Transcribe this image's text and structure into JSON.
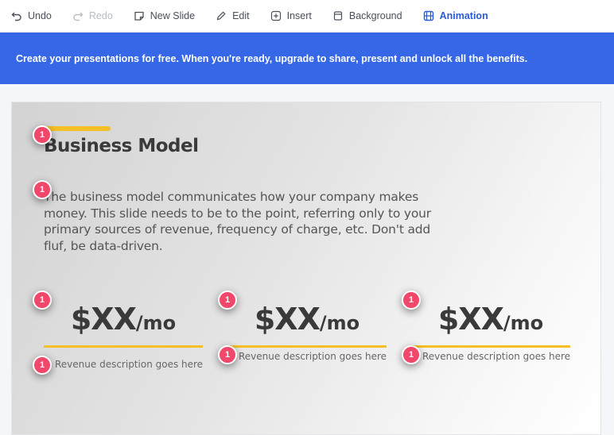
{
  "toolbar": {
    "items": [
      {
        "label": "Undo",
        "icon": "undo-icon",
        "state": "normal"
      },
      {
        "label": "Redo",
        "icon": "redo-icon",
        "state": "disabled"
      },
      {
        "label": "New Slide",
        "icon": "new-slide-icon",
        "state": "normal"
      },
      {
        "label": "Edit",
        "icon": "pencil-icon",
        "state": "normal"
      },
      {
        "label": "Insert",
        "icon": "plus-box-icon",
        "state": "normal"
      },
      {
        "label": "Background",
        "icon": "background-icon",
        "state": "normal"
      },
      {
        "label": "Animation",
        "icon": "animation-icon",
        "state": "active"
      }
    ]
  },
  "banner": {
    "text": "Create your presentations for free. When you're ready, upgrade to share, present and unlock all the benefits."
  },
  "slide": {
    "title": "Business Model",
    "description": "The business model communicates how your company makes money. This slide needs to be to the point, referring only to your primary sources of revenue, frequency of charge, etc. Don't add fluf, be data-driven.",
    "prices": [
      {
        "amount": "$XX",
        "period": "/mo",
        "description": "Revenue description goes here"
      },
      {
        "amount": "$XX",
        "period": "/mo",
        "description": "Revenue description goes here"
      },
      {
        "amount": "$XX",
        "period": "/mo",
        "description": "Revenue description goes here"
      }
    ],
    "badge_label": "1"
  },
  "colors": {
    "accent": "#3567e6",
    "active": "#2a5bd7",
    "underline": "#f5bf26",
    "badge": "#f0476a"
  }
}
